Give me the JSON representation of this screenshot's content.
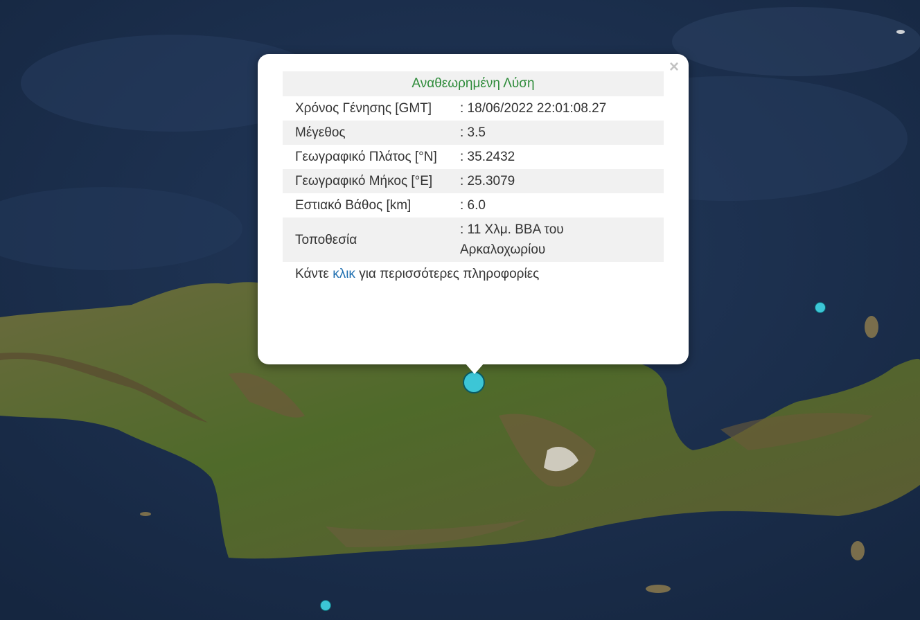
{
  "popup": {
    "close_icon": "×",
    "header": "Αναθεωρημένη Λύση",
    "rows": [
      {
        "label": "Χρόνος Γένησης [GMT]",
        "value": ": 18/06/2022 22:01:08.27"
      },
      {
        "label": "Μέγεθος",
        "value": ": 3.5"
      },
      {
        "label": "Γεωγραφικό Πλάτος [°N]",
        "value": ": 35.2432"
      },
      {
        "label": "Γεωγραφικό Μήκος [°E]",
        "value": ": 25.3079"
      },
      {
        "label": "Εστιακό Βάθος [km]",
        "value": ": 6.0"
      },
      {
        "label": "Τοποθεσία",
        "value": ": 11 Χλμ. ΒΒΑ του Αρκαλοχωρίου"
      }
    ],
    "more_prefix": "Κάντε ",
    "more_link": "κλικ",
    "more_suffix": " για περισσότερες πληροφορίες"
  },
  "colors": {
    "sea": "#1b2f4d",
    "land": "#4e5a2c",
    "marker": "#3cc6d6",
    "header_text": "#2e8b3a",
    "link": "#1f6fb0"
  }
}
